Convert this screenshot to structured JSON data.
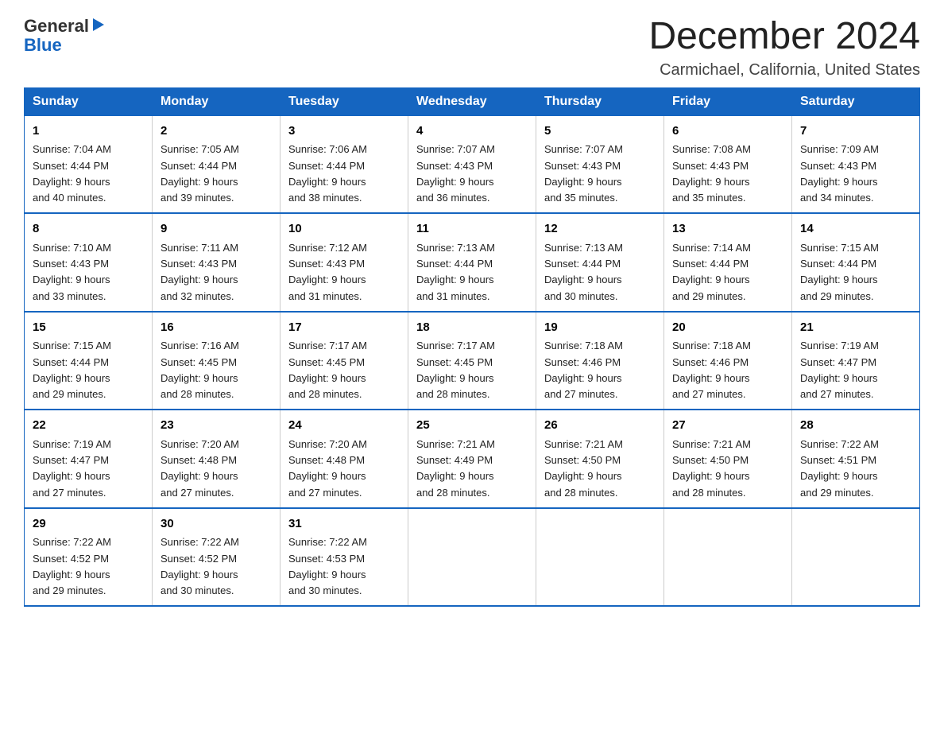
{
  "header": {
    "logo": {
      "general": "General",
      "arrow": "▶",
      "blue": "Blue"
    },
    "title": "December 2024",
    "subtitle": "Carmichael, California, United States"
  },
  "weekdays": [
    "Sunday",
    "Monday",
    "Tuesday",
    "Wednesday",
    "Thursday",
    "Friday",
    "Saturday"
  ],
  "weeks": [
    [
      {
        "day": "1",
        "sunrise": "7:04 AM",
        "sunset": "4:44 PM",
        "daylight": "9 hours and 40 minutes."
      },
      {
        "day": "2",
        "sunrise": "7:05 AM",
        "sunset": "4:44 PM",
        "daylight": "9 hours and 39 minutes."
      },
      {
        "day": "3",
        "sunrise": "7:06 AM",
        "sunset": "4:44 PM",
        "daylight": "9 hours and 38 minutes."
      },
      {
        "day": "4",
        "sunrise": "7:07 AM",
        "sunset": "4:43 PM",
        "daylight": "9 hours and 36 minutes."
      },
      {
        "day": "5",
        "sunrise": "7:07 AM",
        "sunset": "4:43 PM",
        "daylight": "9 hours and 35 minutes."
      },
      {
        "day": "6",
        "sunrise": "7:08 AM",
        "sunset": "4:43 PM",
        "daylight": "9 hours and 35 minutes."
      },
      {
        "day": "7",
        "sunrise": "7:09 AM",
        "sunset": "4:43 PM",
        "daylight": "9 hours and 34 minutes."
      }
    ],
    [
      {
        "day": "8",
        "sunrise": "7:10 AM",
        "sunset": "4:43 PM",
        "daylight": "9 hours and 33 minutes."
      },
      {
        "day": "9",
        "sunrise": "7:11 AM",
        "sunset": "4:43 PM",
        "daylight": "9 hours and 32 minutes."
      },
      {
        "day": "10",
        "sunrise": "7:12 AM",
        "sunset": "4:43 PM",
        "daylight": "9 hours and 31 minutes."
      },
      {
        "day": "11",
        "sunrise": "7:13 AM",
        "sunset": "4:44 PM",
        "daylight": "9 hours and 31 minutes."
      },
      {
        "day": "12",
        "sunrise": "7:13 AM",
        "sunset": "4:44 PM",
        "daylight": "9 hours and 30 minutes."
      },
      {
        "day": "13",
        "sunrise": "7:14 AM",
        "sunset": "4:44 PM",
        "daylight": "9 hours and 29 minutes."
      },
      {
        "day": "14",
        "sunrise": "7:15 AM",
        "sunset": "4:44 PM",
        "daylight": "9 hours and 29 minutes."
      }
    ],
    [
      {
        "day": "15",
        "sunrise": "7:15 AM",
        "sunset": "4:44 PM",
        "daylight": "9 hours and 29 minutes."
      },
      {
        "day": "16",
        "sunrise": "7:16 AM",
        "sunset": "4:45 PM",
        "daylight": "9 hours and 28 minutes."
      },
      {
        "day": "17",
        "sunrise": "7:17 AM",
        "sunset": "4:45 PM",
        "daylight": "9 hours and 28 minutes."
      },
      {
        "day": "18",
        "sunrise": "7:17 AM",
        "sunset": "4:45 PM",
        "daylight": "9 hours and 28 minutes."
      },
      {
        "day": "19",
        "sunrise": "7:18 AM",
        "sunset": "4:46 PM",
        "daylight": "9 hours and 27 minutes."
      },
      {
        "day": "20",
        "sunrise": "7:18 AM",
        "sunset": "4:46 PM",
        "daylight": "9 hours and 27 minutes."
      },
      {
        "day": "21",
        "sunrise": "7:19 AM",
        "sunset": "4:47 PM",
        "daylight": "9 hours and 27 minutes."
      }
    ],
    [
      {
        "day": "22",
        "sunrise": "7:19 AM",
        "sunset": "4:47 PM",
        "daylight": "9 hours and 27 minutes."
      },
      {
        "day": "23",
        "sunrise": "7:20 AM",
        "sunset": "4:48 PM",
        "daylight": "9 hours and 27 minutes."
      },
      {
        "day": "24",
        "sunrise": "7:20 AM",
        "sunset": "4:48 PM",
        "daylight": "9 hours and 27 minutes."
      },
      {
        "day": "25",
        "sunrise": "7:21 AM",
        "sunset": "4:49 PM",
        "daylight": "9 hours and 28 minutes."
      },
      {
        "day": "26",
        "sunrise": "7:21 AM",
        "sunset": "4:50 PM",
        "daylight": "9 hours and 28 minutes."
      },
      {
        "day": "27",
        "sunrise": "7:21 AM",
        "sunset": "4:50 PM",
        "daylight": "9 hours and 28 minutes."
      },
      {
        "day": "28",
        "sunrise": "7:22 AM",
        "sunset": "4:51 PM",
        "daylight": "9 hours and 29 minutes."
      }
    ],
    [
      {
        "day": "29",
        "sunrise": "7:22 AM",
        "sunset": "4:52 PM",
        "daylight": "9 hours and 29 minutes."
      },
      {
        "day": "30",
        "sunrise": "7:22 AM",
        "sunset": "4:52 PM",
        "daylight": "9 hours and 30 minutes."
      },
      {
        "day": "31",
        "sunrise": "7:22 AM",
        "sunset": "4:53 PM",
        "daylight": "9 hours and 30 minutes."
      },
      null,
      null,
      null,
      null
    ]
  ]
}
